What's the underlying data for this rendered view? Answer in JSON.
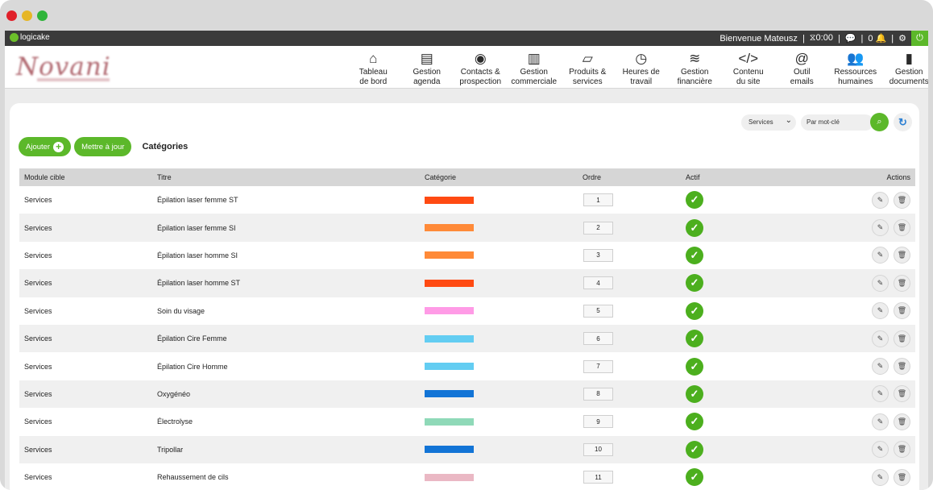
{
  "window": {
    "controls": [
      "close",
      "minimize",
      "maximize"
    ]
  },
  "topbar": {
    "app_logo": "logicake",
    "welcome": "Bienvenue Mateusz",
    "timer_icon": "hourglass-icon",
    "timer": "0:00",
    "chat_icon": "chat-icon",
    "notif_count": "0",
    "bell_icon": "bell-icon",
    "settings_icon": "gears-icon",
    "power_icon": "power-icon",
    "accent": "#5cb82a"
  },
  "brand": {
    "name": "Novani"
  },
  "nav": [
    {
      "icon": "⌂",
      "icon_name": "home-icon",
      "label": "Tableau\nde bord"
    },
    {
      "icon": "▤",
      "icon_name": "agenda-icon",
      "label": "Gestion\nagenda"
    },
    {
      "icon": "◉",
      "icon_name": "target-icon",
      "label": "Contacts &\nprospection"
    },
    {
      "icon": "▥",
      "icon_name": "document-icon",
      "label": "Gestion\ncommerciale"
    },
    {
      "icon": "▱",
      "icon_name": "products-icon",
      "label": "Produits &\nservices"
    },
    {
      "icon": "◷",
      "icon_name": "clock-icon",
      "label": "Heures de\ntravail"
    },
    {
      "icon": "≋",
      "icon_name": "coins-icon",
      "label": "Gestion\nfinancière"
    },
    {
      "icon": "</>",
      "icon_name": "code-icon",
      "label": "Contenu\ndu site"
    },
    {
      "icon": "@",
      "icon_name": "at-icon",
      "label": "Outil\nemails"
    },
    {
      "icon": "👥",
      "icon_name": "users-icon",
      "label": "Ressources\nhumaines"
    },
    {
      "icon": "▮",
      "icon_name": "file-icon",
      "label": "Gestion\ndocuments"
    }
  ],
  "filters": {
    "module_select": "Services",
    "search_placeholder": "Par mot-clé"
  },
  "toolbar": {
    "add_label": "Ajouter",
    "update_label": "Mettre à jour",
    "section_title": "Catégories"
  },
  "table": {
    "headers": {
      "module": "Module cible",
      "title": "Titre",
      "category": "Catégorie",
      "order": "Ordre",
      "active": "Actif",
      "actions": "Actions"
    },
    "rows": [
      {
        "module": "Services",
        "title": "Épilation laser femme ST",
        "color": "#ff4a12",
        "order": "1"
      },
      {
        "module": "Services",
        "title": "Épilation laser femme SI",
        "color": "#ff8a38",
        "order": "2"
      },
      {
        "module": "Services",
        "title": "Épilation laser homme SI",
        "color": "#ff8a38",
        "order": "3"
      },
      {
        "module": "Services",
        "title": "Épilation laser homme ST",
        "color": "#ff4a12",
        "order": "4"
      },
      {
        "module": "Services",
        "title": "Soin du visage",
        "color": "#ff9be6",
        "order": "5"
      },
      {
        "module": "Services",
        "title": "Épilation Cire Femme",
        "color": "#63cdf2",
        "order": "6"
      },
      {
        "module": "Services",
        "title": "Épilation Cire Homme",
        "color": "#63cdf2",
        "order": "7"
      },
      {
        "module": "Services",
        "title": "Oxygénéo",
        "color": "#1274d6",
        "order": "8"
      },
      {
        "module": "Services",
        "title": "Électrolyse",
        "color": "#8fd9b8",
        "order": "9"
      },
      {
        "module": "Services",
        "title": "Tripollar",
        "color": "#1274d6",
        "order": "10"
      },
      {
        "module": "Services",
        "title": "Rehaussement de cils",
        "color": "#eab8c4",
        "order": "11"
      }
    ]
  }
}
